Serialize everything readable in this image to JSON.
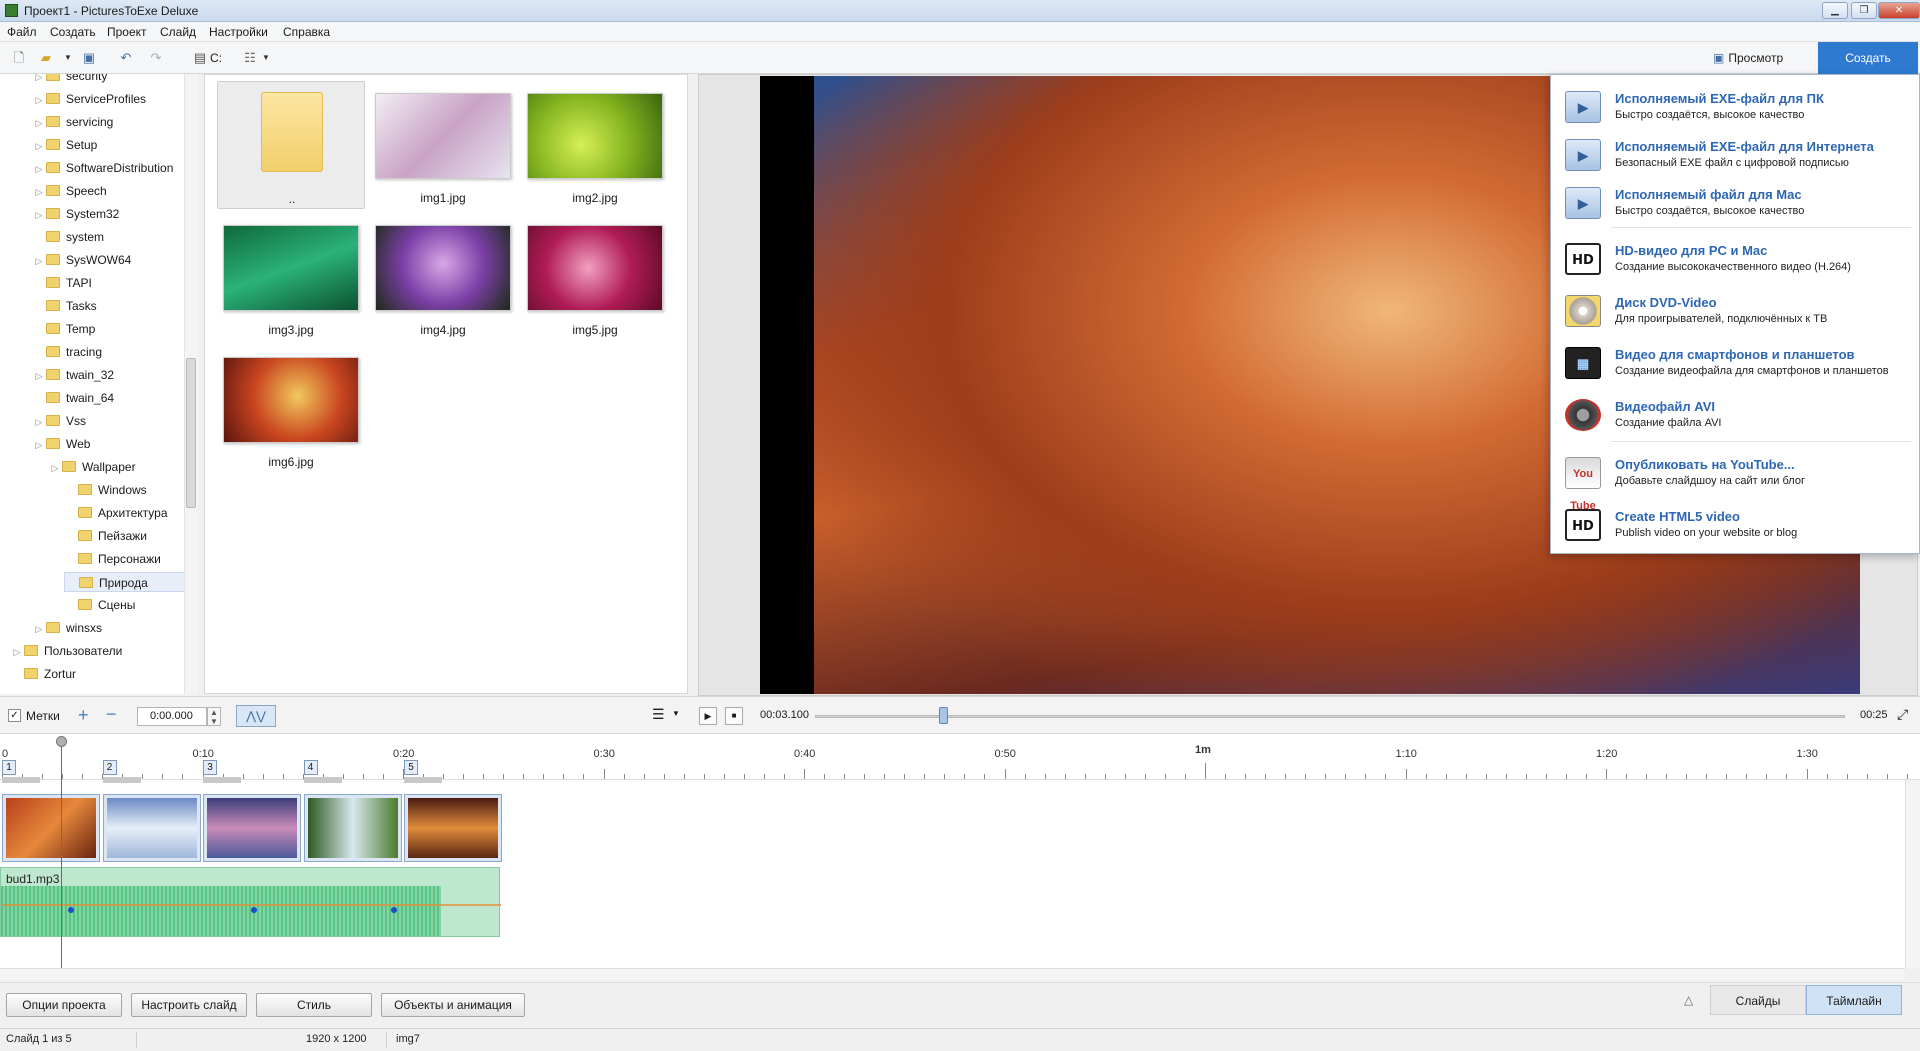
{
  "window": {
    "title": "Проект1 - PicturesToExe Deluxe",
    "minimize": "▁",
    "maximize": "❐",
    "close": "✕"
  },
  "menu": [
    "Файл",
    "Создать",
    "Проект",
    "Слайд",
    "Настройки",
    "Справка"
  ],
  "toolbar": {
    "drive_label": "C:",
    "preview_label": "Просмотр",
    "create_label": "Создать"
  },
  "tree": [
    {
      "label": "security",
      "indent": 1,
      "arrow": true
    },
    {
      "label": "ServiceProfiles",
      "indent": 1,
      "arrow": true
    },
    {
      "label": "servicing",
      "indent": 1,
      "arrow": true
    },
    {
      "label": "Setup",
      "indent": 1,
      "arrow": true
    },
    {
      "label": "SoftwareDistribution",
      "indent": 1,
      "arrow": true
    },
    {
      "label": "Speech",
      "indent": 1,
      "arrow": true
    },
    {
      "label": "System32",
      "indent": 1,
      "arrow": true
    },
    {
      "label": "system",
      "indent": 1,
      "arrow": false
    },
    {
      "label": "SysWOW64",
      "indent": 1,
      "arrow": true
    },
    {
      "label": "TAPI",
      "indent": 1,
      "arrow": false
    },
    {
      "label": "Tasks",
      "indent": 1,
      "arrow": false
    },
    {
      "label": "Temp",
      "indent": 1,
      "arrow": false
    },
    {
      "label": "tracing",
      "indent": 1,
      "arrow": false
    },
    {
      "label": "twain_32",
      "indent": 1,
      "arrow": true
    },
    {
      "label": "twain_64",
      "indent": 1,
      "arrow": false
    },
    {
      "label": "Vss",
      "indent": 1,
      "arrow": true
    },
    {
      "label": "Web",
      "indent": 1,
      "arrow": true
    },
    {
      "label": "Wallpaper",
      "indent": 2,
      "arrow": true
    },
    {
      "label": "Windows",
      "indent": 3,
      "arrow": false
    },
    {
      "label": "Архитектура",
      "indent": 3,
      "arrow": false
    },
    {
      "label": "Пейзажи",
      "indent": 3,
      "arrow": false
    },
    {
      "label": "Персонажи",
      "indent": 3,
      "arrow": false
    },
    {
      "label": "Природа",
      "indent": 3,
      "arrow": false,
      "selected": true
    },
    {
      "label": "Сцены",
      "indent": 3,
      "arrow": false
    },
    {
      "label": "winsxs",
      "indent": 1,
      "arrow": true
    },
    {
      "label": "Пользователи",
      "indent": 0,
      "arrow": true
    },
    {
      "label": "Zortur",
      "indent": 0,
      "arrow": false
    }
  ],
  "files": [
    {
      "name": "..",
      "thumb": "folder"
    },
    {
      "name": "img1.jpg",
      "thumb": "linear-gradient(135deg,#f2eef3,#c9a2c6,#e7e3ef)"
    },
    {
      "name": "img2.jpg",
      "thumb": "radial-gradient(circle at 40% 60%,#d7ef55,#84b51f,#3c6410)"
    },
    {
      "name": "img3.jpg",
      "thumb": "linear-gradient(160deg,#0f6a3a,#2bb27a,#0c5230)"
    },
    {
      "name": "img4.jpg",
      "thumb": "radial-gradient(circle at 50% 45%,#d8a8e8,#7b3fa6,#1c2a18)"
    },
    {
      "name": "img5.jpg",
      "thumb": "radial-gradient(circle at 45% 50%,#f1a0c0,#b01c56,#5c0b26)"
    },
    {
      "name": "img6.jpg",
      "thumb": "radial-gradient(circle at 55% 45%,#f2c95d,#c9461f,#5a1410)"
    }
  ],
  "create_menu": [
    {
      "icon": "exe",
      "glyph": "▶",
      "title": "Исполняемый EXE-файл для ПК",
      "desc": "Быстро создаётся, высокое качество"
    },
    {
      "icon": "exe",
      "glyph": "▶",
      "title": "Исполняемый EXE-файл для Интернета",
      "desc": "Безопасный EXE файл с цифровой подписью"
    },
    {
      "icon": "exe",
      "glyph": "▶",
      "title": "Исполняемый файл для Mac",
      "desc": "Быстро создаётся, высокое качество"
    },
    {
      "icon": "hd",
      "glyph": "HD",
      "title": "HD-видео для PC и Mac",
      "desc": "Создание высококачественного видео (H.264)"
    },
    {
      "icon": "dvd",
      "glyph": "",
      "title": "Диск DVD-Video",
      "desc": "Для проигрывателей, подключённых к ТВ"
    },
    {
      "icon": "tab",
      "glyph": "▦",
      "title": "Видео для смартфонов и планшетов",
      "desc": "Создание видеофайла для смартфонов и планшетов"
    },
    {
      "icon": "avi",
      "glyph": "",
      "title": "Видеофайл AVI",
      "desc": "Создание файла AVI"
    },
    {
      "icon": "yt",
      "glyph": "You Tube",
      "title": "Опубликовать на YouTube...",
      "desc": "Добавьте слайдшоу на сайт или блог"
    },
    {
      "icon": "hd",
      "glyph": "HD",
      "title": "Create HTML5 video",
      "desc": "Publish video on your website or blog"
    }
  ],
  "playbar": {
    "marks_label": "Метки",
    "time": "0:00.000",
    "current_time": "00:03.100",
    "total_time": "00:25",
    "progress": 0.124
  },
  "ruler": [
    "0",
    "0:10",
    "0:20",
    "0:30",
    "0:40",
    "0:50",
    "1m",
    "1:10",
    "1:20",
    "1:30"
  ],
  "slides": [
    {
      "num": "1",
      "color": "linear-gradient(135deg,#b9401c,#e6883b,#6b2412)"
    },
    {
      "num": "2",
      "color": "linear-gradient(180deg,#6b8ac6,#e7eef7,#9fb7dc)"
    },
    {
      "num": "3",
      "color": "linear-gradient(180deg,#3c3f7c,#c98bb9,#4b5a9a)"
    },
    {
      "num": "4",
      "color": "linear-gradient(90deg,#2f5a22,#d7e8ee,#4b7a2c)"
    },
    {
      "num": "5",
      "color": "linear-gradient(180deg,#4d1a12,#e08c3c,#5b2612)"
    }
  ],
  "audio": {
    "file": "bud1.mp3"
  },
  "bottom": {
    "btn_options": "Опции проекта",
    "btn_slide": "Настроить слайд",
    "btn_style": "Стиль",
    "btn_objects": "Объекты и анимация",
    "tab_slides": "Слайды",
    "tab_timeline": "Таймлайн"
  },
  "status": {
    "slide": "Слайд 1 из 5",
    "size": "1920 x 1200",
    "name": "img7"
  }
}
